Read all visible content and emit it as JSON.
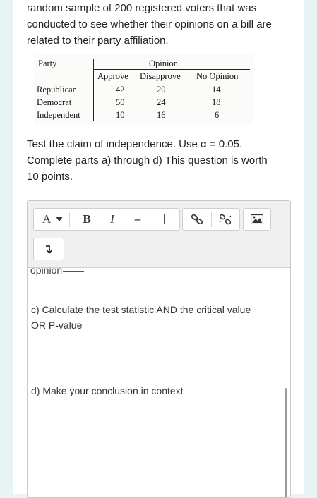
{
  "question": {
    "intro_lines": [
      "random sample of 200 registered voters that was",
      "conducted to see whether their opinions on a bill are",
      "related to their party affiliation."
    ],
    "claim_lines": [
      "Test the claim of independence. Use α = 0.05.",
      "Complete parts a) through d) This question is worth",
      "10 points."
    ]
  },
  "table": {
    "row_header": "Party",
    "col_group": "Opinion",
    "columns": [
      "Approve",
      "Disapprove",
      "No Opinion"
    ],
    "rows": [
      {
        "party": "Republican",
        "values": [
          "42",
          "20",
          "14"
        ]
      },
      {
        "party": "Democrat",
        "values": [
          "50",
          "24",
          "18"
        ]
      },
      {
        "party": "Independent",
        "values": [
          "10",
          "16",
          "6"
        ]
      }
    ]
  },
  "toolbar": {
    "font_menu": "A",
    "bold": "B",
    "italic": "I",
    "strike": "–",
    "cursor": "I"
  },
  "editor": {
    "cut_text": "opinion",
    "part_c_lines": [
      "c) Calculate the test statistic AND the critical value",
      "OR P-value"
    ],
    "part_d": "d) Make your conclusion in context"
  }
}
